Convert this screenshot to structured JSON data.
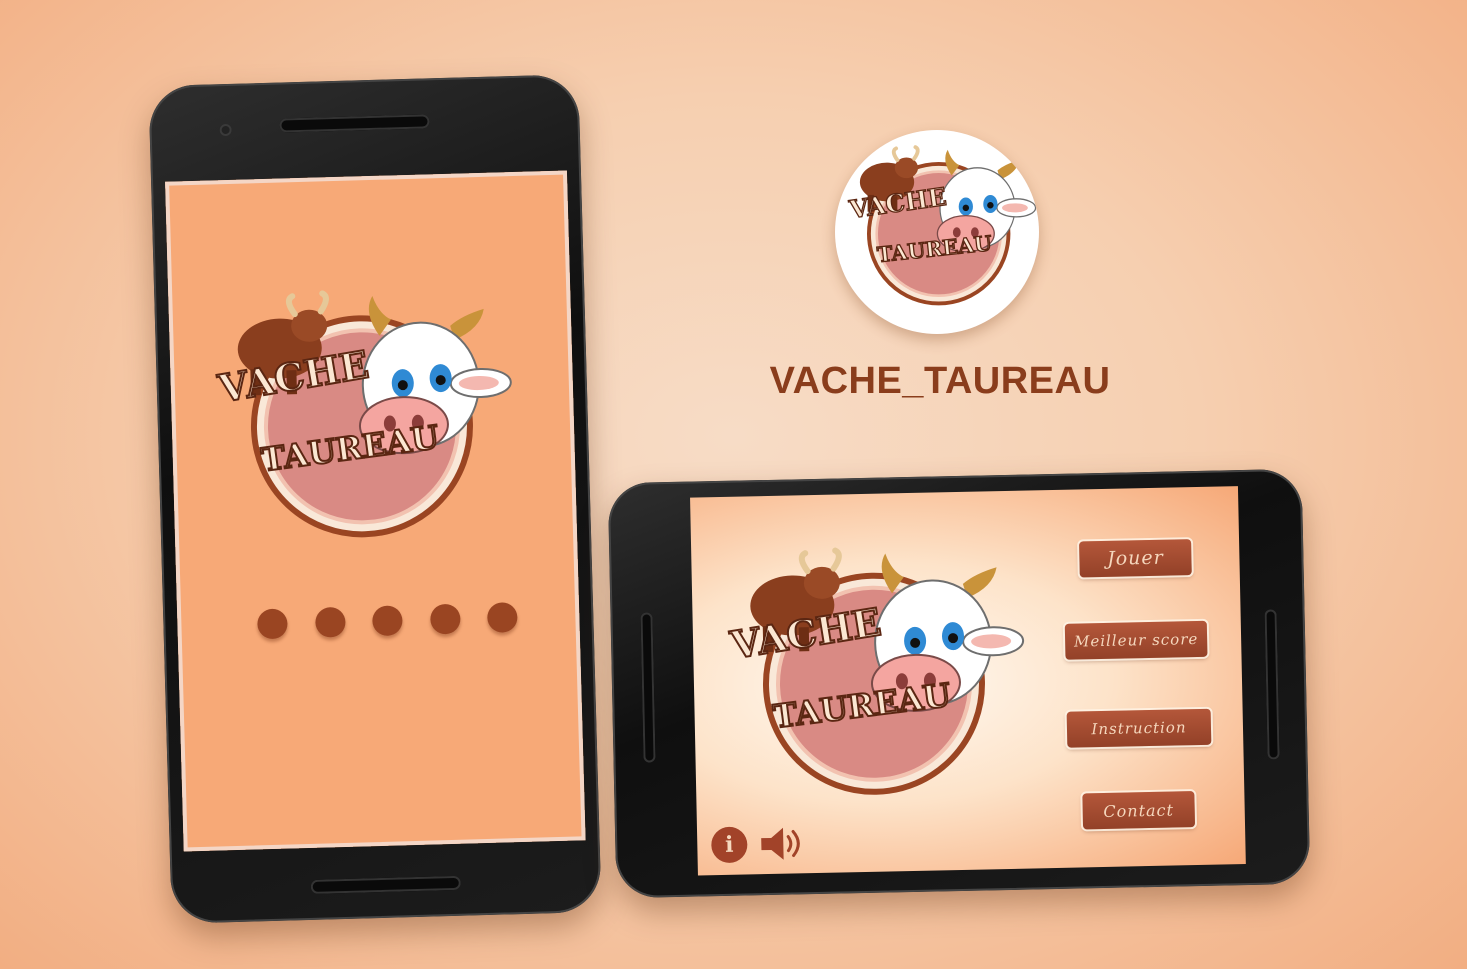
{
  "brand": {
    "logo_line1": "VACHE",
    "logo_line2": "TAUREAU",
    "colors": {
      "accent": "#9a4522",
      "button": "#a04a2e",
      "screen": "#f7a977",
      "title": "#8a3d1c"
    }
  },
  "app_title": "VACHE_TAUREAU",
  "app_icon": {
    "icon": "cow-bull-logo-icon"
  },
  "portrait_screen": {
    "loading_dots": 5
  },
  "landscape_screen": {
    "menu": {
      "play": "Jouer",
      "best_score": "Meilleur score",
      "instruction": "Instruction",
      "contact": "Contact"
    },
    "info_label": "i",
    "icons": {
      "info": "info-icon",
      "sound": "speaker-icon"
    }
  }
}
